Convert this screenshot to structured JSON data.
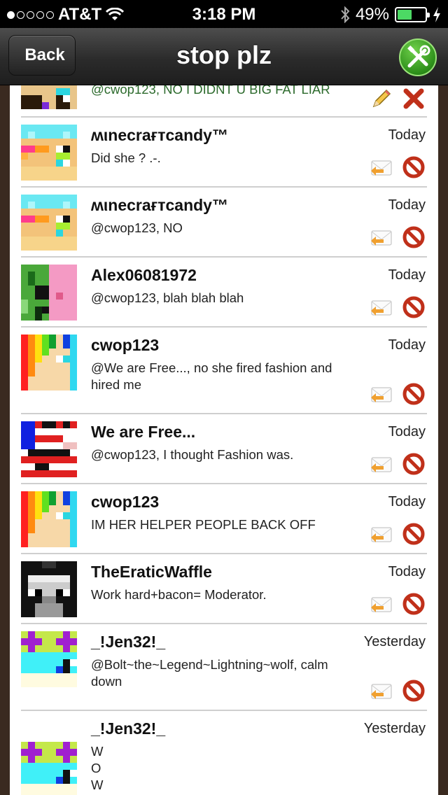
{
  "status": {
    "carrier": "AT&T",
    "time": "3:18 PM",
    "battery": "49%"
  },
  "nav": {
    "back_label": "Back",
    "title": "stop plz"
  },
  "partial_comment": {
    "text": "@cwop123, NO I DIDNT U BIG FAT LIAR"
  },
  "comments": [
    {
      "user": "ʍιnecraғтcandy™",
      "when": "Today",
      "text": "Did she ? .-."
    },
    {
      "user": "ʍιnecraғтcandy™",
      "when": "Today",
      "text": "@cwop123, NO"
    },
    {
      "user": "Alex06081972",
      "when": "Today",
      "text": "@cwop123, blah blah blah"
    },
    {
      "user": "cwop123",
      "when": "Today",
      "text": "@We are Free..., no she fired fashion and hired me"
    },
    {
      "user": "We are Free...",
      "when": "Today",
      "text": "@cwop123, I thought Fashion was."
    },
    {
      "user": "cwop123",
      "when": "Today",
      "text": "IM HER HELPER PEOPLE BACK OFF"
    },
    {
      "user": "TheEraticWaffle",
      "when": "Today",
      "text": "Work hard+bacon= Moderator."
    },
    {
      "user": "_!Jen32!_",
      "when": "Yesterday",
      "text": "@Bolt~the~Legend~Lightning~wolf, calm down"
    },
    {
      "user": "_!Jen32!_",
      "when": "Yesterday",
      "text_lines": [
        "W",
        "O",
        "W"
      ]
    }
  ],
  "icons": {
    "reply": "reply-envelope-icon",
    "block": "block-icon",
    "edit": "pencil-icon",
    "delete": "delete-x-icon",
    "tools": "tools-icon"
  },
  "colors": {
    "accent_green": "#3aa624",
    "block_red": "#c0301a",
    "reply_orange": "#f0a030"
  }
}
